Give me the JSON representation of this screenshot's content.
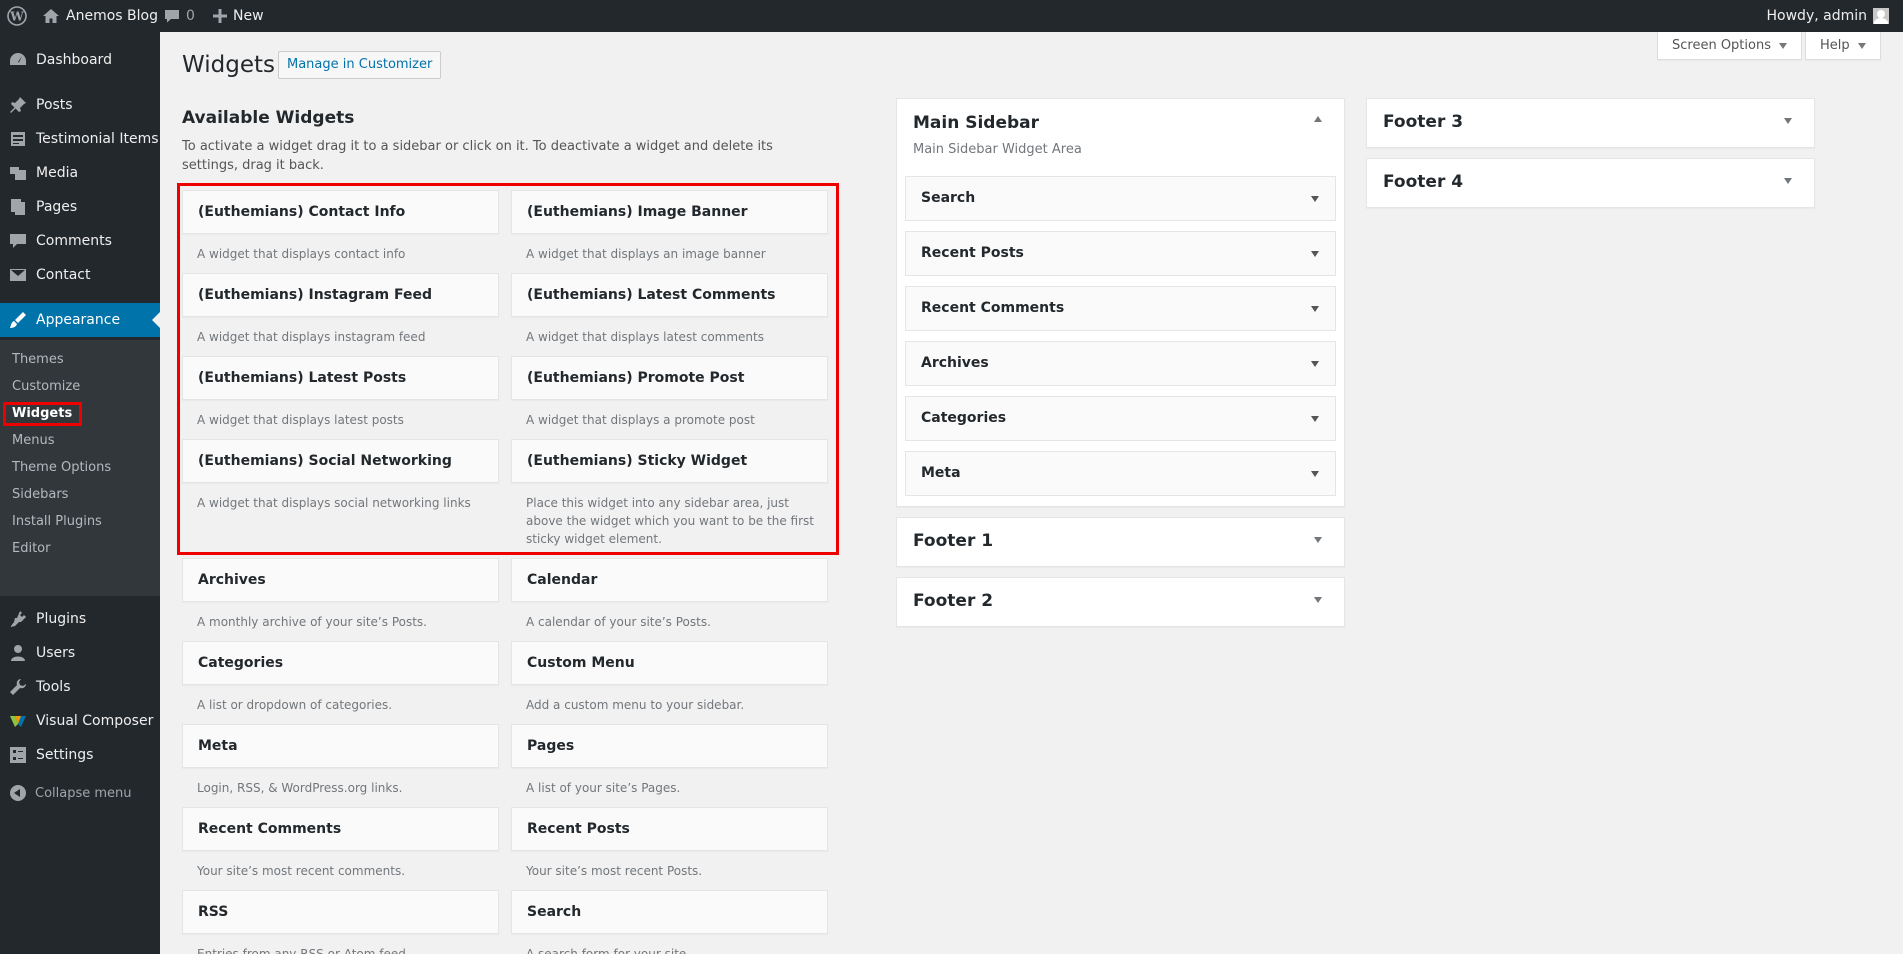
{
  "adminbar": {
    "site_name": "Anemos Blog",
    "comments_count": "0",
    "new_label": "New",
    "howdy": "Howdy, admin"
  },
  "sidebar": {
    "items": [
      {
        "label": "Dashboard",
        "icon": "dashboard-icon"
      },
      {
        "label": "Posts",
        "icon": "pushpin-icon"
      },
      {
        "label": "Testimonial Items",
        "icon": "list-icon"
      },
      {
        "label": "Media",
        "icon": "media-icon"
      },
      {
        "label": "Pages",
        "icon": "page-icon"
      },
      {
        "label": "Comments",
        "icon": "comment-icon"
      },
      {
        "label": "Contact",
        "icon": "mail-icon"
      },
      {
        "label": "Appearance",
        "icon": "paintbrush-icon"
      },
      {
        "label": "Plugins",
        "icon": "plugin-icon"
      },
      {
        "label": "Users",
        "icon": "users-icon"
      },
      {
        "label": "Tools",
        "icon": "wrench-icon"
      },
      {
        "label": "Visual Composer",
        "icon": "visual-composer-icon"
      },
      {
        "label": "Settings",
        "icon": "settings-icon"
      }
    ],
    "submenu": [
      "Themes",
      "Customize",
      "Widgets",
      "Menus",
      "Theme Options",
      "Sidebars",
      "Install Plugins",
      "Editor"
    ],
    "collapse_label": "Collapse menu"
  },
  "header": {
    "title": "Widgets",
    "manage_label": "Manage in Customizer",
    "screen_options": "Screen Options",
    "help": "Help"
  },
  "available": {
    "title": "Available Widgets",
    "description": "To activate a widget drag it to a sidebar or click on it. To deactivate a widget and delete its settings, drag it back.",
    "widgets": [
      {
        "name": "(Euthemians) Contact Info",
        "desc": "A widget that displays contact info"
      },
      {
        "name": "(Euthemians) Image Banner",
        "desc": "A widget that displays an image banner"
      },
      {
        "name": "(Euthemians) Instagram Feed",
        "desc": "A widget that displays instagram feed"
      },
      {
        "name": "(Euthemians) Latest Comments",
        "desc": "A widget that displays latest comments"
      },
      {
        "name": "(Euthemians) Latest Posts",
        "desc": "A widget that displays latest posts"
      },
      {
        "name": "(Euthemians) Promote Post",
        "desc": "A widget that displays a promote post"
      },
      {
        "name": "(Euthemians) Social Networking",
        "desc": "A widget that displays social networking links"
      },
      {
        "name": "(Euthemians) Sticky Widget",
        "desc": "Place this widget into any sidebar area, just above the widget which you want to be the first sticky widget element."
      },
      {
        "name": "Archives",
        "desc": "A monthly archive of your site’s Posts."
      },
      {
        "name": "Calendar",
        "desc": "A calendar of your site’s Posts."
      },
      {
        "name": "Categories",
        "desc": "A list or dropdown of categories."
      },
      {
        "name": "Custom Menu",
        "desc": "Add a custom menu to your sidebar."
      },
      {
        "name": "Meta",
        "desc": "Login, RSS, & WordPress.org links."
      },
      {
        "name": "Pages",
        "desc": "A list of your site’s Pages."
      },
      {
        "name": "Recent Comments",
        "desc": "Your site’s most recent comments."
      },
      {
        "name": "Recent Posts",
        "desc": "Your site’s most recent Posts."
      },
      {
        "name": "RSS",
        "desc": "Entries from any RSS or Atom feed."
      },
      {
        "name": "Search",
        "desc": "A search form for your site."
      }
    ]
  },
  "areas": {
    "main_sidebar": {
      "title": "Main Sidebar",
      "description": "Main Sidebar Widget Area",
      "widgets": [
        "Search",
        "Recent Posts",
        "Recent Comments",
        "Archives",
        "Categories",
        "Meta"
      ]
    },
    "footer1": "Footer 1",
    "footer2": "Footer 2",
    "footer3": "Footer 3",
    "footer4": "Footer 4"
  }
}
